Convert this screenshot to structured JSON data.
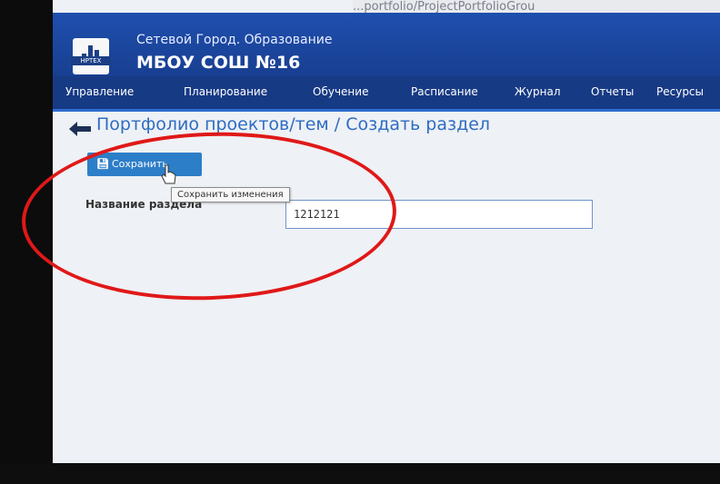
{
  "browser": {
    "url_fragment": "...portfolio/ProjectPortfolioGrou"
  },
  "header": {
    "logo_badge": "НРТЕХ",
    "system_name": "Сетевой Город. Образование",
    "school_name": "МБОУ СОШ №16"
  },
  "nav": {
    "items": [
      {
        "label": "Управление"
      },
      {
        "label": "Планирование"
      },
      {
        "label": "Обучение"
      },
      {
        "label": "Расписание"
      },
      {
        "label": "Журнал"
      },
      {
        "label": "Отчеты"
      },
      {
        "label": "Ресурсы"
      }
    ]
  },
  "page": {
    "title": "Портфолио проектов/тем / Создать раздел"
  },
  "toolbar": {
    "save_label": "Сохранить",
    "save_tooltip": "Сохранить изменения"
  },
  "form": {
    "section_name_label": "Название раздела",
    "section_name_value": "1212121"
  },
  "colors": {
    "header_bg": "#1f4fae",
    "nav_bg": "#173a84",
    "accent": "#2e6cc4",
    "annotation": "#e01818"
  }
}
